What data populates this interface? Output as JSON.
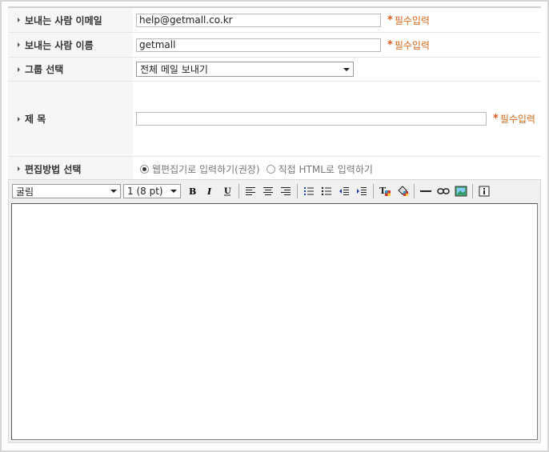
{
  "form": {
    "sender_email": {
      "label": "보내는 사람 이메일",
      "value": "help@getmall.co.kr",
      "required": "필수입력"
    },
    "sender_name": {
      "label": "보내는 사람 이름",
      "value": "getmall",
      "required": "필수입력"
    },
    "group": {
      "label": "그룹 선택",
      "selected": "전체 메일 보내기"
    },
    "subject": {
      "label": "제 목",
      "value": "",
      "required": "필수입력"
    },
    "edit_mode": {
      "label": "편집방법 선택",
      "options": [
        {
          "label": "웹편집기로 입력하기(권장)",
          "checked": true
        },
        {
          "label": "직접 HTML로 입력하기",
          "checked": false
        }
      ]
    }
  },
  "editor": {
    "font_select": "굴림",
    "size_select": "1 (8 pt)",
    "body": ""
  },
  "colors": {
    "required_text": "#d2691e",
    "label_bg": "#f6f6f6"
  }
}
